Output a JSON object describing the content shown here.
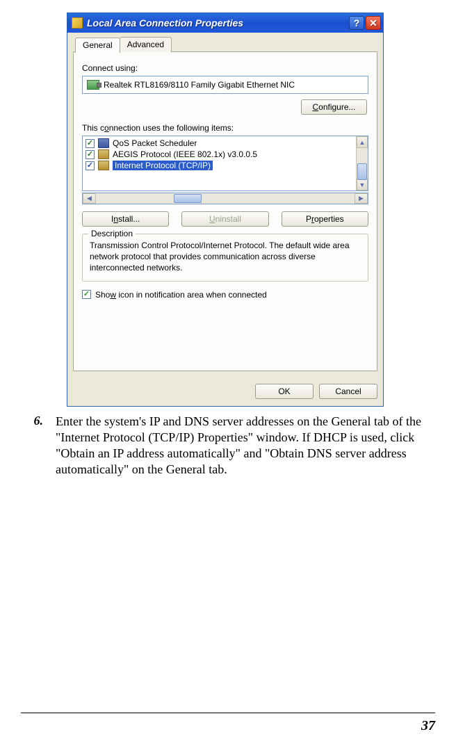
{
  "dialog": {
    "title": "Local Area Connection Properties",
    "tabs": {
      "general": "General",
      "advanced": "Advanced"
    },
    "connect_using_label": "Connect using:",
    "adapter_name": "Realtek RTL8169/8110 Family Gigabit Ethernet NIC",
    "configure_button": "Configure...",
    "items_label": "This connection uses the following items:",
    "items": [
      {
        "label": "QoS Packet Scheduler"
      },
      {
        "label": "AEGIS Protocol (IEEE 802.1x) v3.0.0.5"
      },
      {
        "label": "Internet Protocol (TCP/IP)"
      }
    ],
    "install_button": "Install...",
    "uninstall_button": "Uninstall",
    "properties_button": "Properties",
    "description_legend": "Description",
    "description_text": "Transmission Control Protocol/Internet Protocol. The default wide area network protocol that provides communication across diverse interconnected networks.",
    "show_icon_label": "Show icon in notification area when connected",
    "ok_button": "OK",
    "cancel_button": "Cancel"
  },
  "instruction": {
    "number": "6.",
    "text": "Enter the system's IP and DNS server addresses on the General tab of the \"Internet Protocol (TCP/IP) Properties\" window.  If DHCP is used, click \"Obtain an IP address automatically\" and \"Obtain DNS server address automatically\" on the General tab."
  },
  "page_number": "37"
}
